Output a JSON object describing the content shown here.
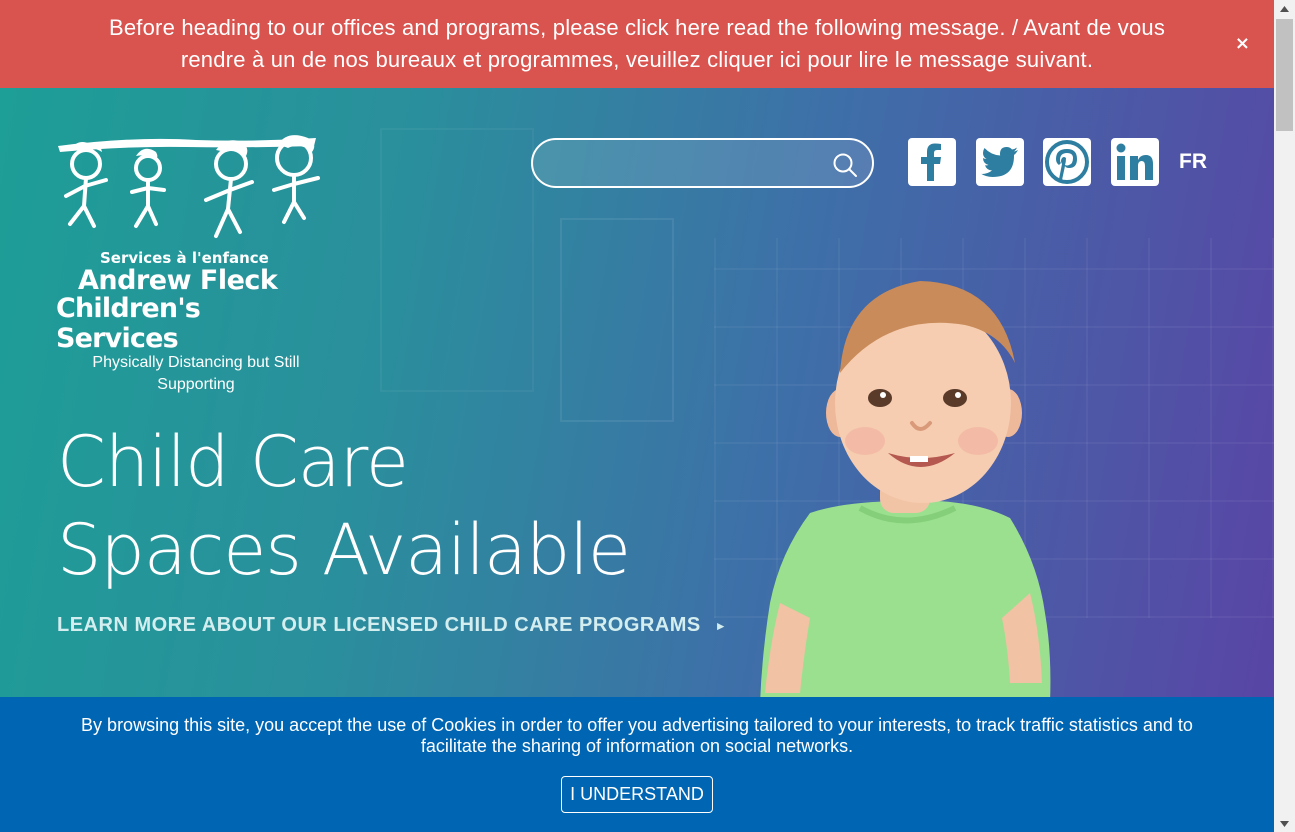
{
  "alert": {
    "message": "Before heading to our offices and programs, please click here read the following message. / Avant de vous rendre à un de nos bureaux et programmes, veuillez cliquer ici pour lire le message suivant.",
    "close_label": "×",
    "background": "#d9534f"
  },
  "logo": {
    "line1": "Services à l'enfance",
    "line2": "Andrew Fleck",
    "line3": "Children's Services",
    "tagline": "Physically Distancing but Still Supporting"
  },
  "search": {
    "placeholder": "",
    "value": "",
    "icon": "search-icon"
  },
  "social": [
    {
      "name": "facebook",
      "icon": "facebook-icon"
    },
    {
      "name": "twitter",
      "icon": "twitter-icon"
    },
    {
      "name": "pinterest",
      "icon": "pinterest-icon"
    },
    {
      "name": "linkedin",
      "icon": "linkedin-icon"
    }
  ],
  "language_toggle": "FR",
  "hero": {
    "headline_line1": "Child Care",
    "headline_line2": "Spaces Available",
    "cta": "LEARN MORE ABOUT OUR LICENSED CHILD CARE PROGRAMS",
    "cta_arrow": "►"
  },
  "cookie_banner": {
    "text": "By browsing this site, you accept the use of Cookies in order to offer you advertising tailored to your interests, to track traffic statistics and to facilitate the sharing of information on social networks.",
    "button": "I UNDERSTAND",
    "background": "#0066b3"
  },
  "colors": {
    "hero_gradient_start": "#1d9e97",
    "hero_gradient_end": "#5a43a5"
  }
}
